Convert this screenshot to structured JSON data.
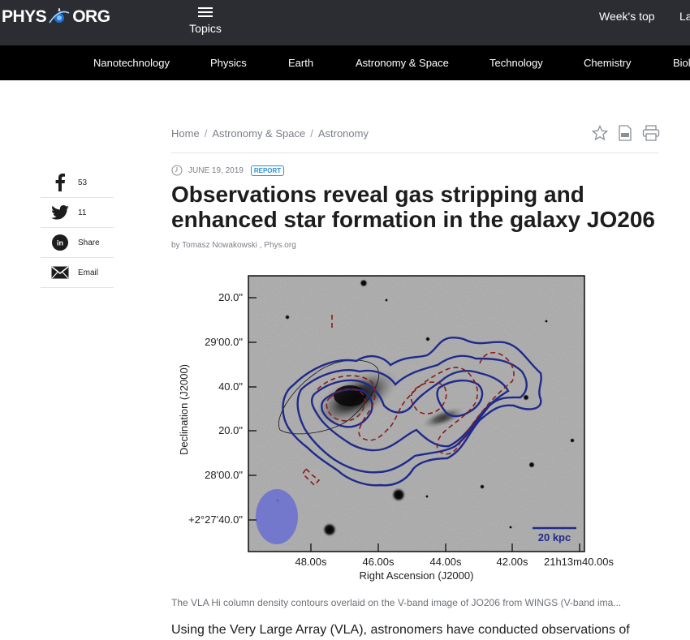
{
  "header": {
    "logo_left": "PHYS",
    "logo_right": "ORG",
    "topics_label": "Topics",
    "weeks_top_label": "Week's top",
    "latest_label": "La"
  },
  "categories": [
    "Nanotechnology",
    "Physics",
    "Earth",
    "Astronomy & Space",
    "Technology",
    "Chemistry",
    "Biol"
  ],
  "breadcrumb": [
    "Home",
    "Astronomy & Space",
    "Astronomy"
  ],
  "breadcrumb_sep": "/",
  "article": {
    "date": "JUNE 19, 2019",
    "badge": "REPORT",
    "title_line1": "Observations reveal gas stripping and",
    "title_line2": "enhanced star formation in the galaxy JO206",
    "byline": "by Tomasz Nowakowski , Phys.org",
    "caption": "The VLA Hi column density contours overlaid on the V-band image of JO206 from WINGS (V-band ima...",
    "lede": "Using the Very Large Array (VLA), astronomers have conducted observations of"
  },
  "share": [
    {
      "icon": "facebook-icon",
      "label": "53"
    },
    {
      "icon": "twitter-icon",
      "label": "11"
    },
    {
      "icon": "linkedin-icon",
      "label": "Share"
    },
    {
      "icon": "email-icon",
      "label": "Email"
    }
  ],
  "figure": {
    "ylabel": "Declination (J2000)",
    "xlabel": "Right Ascension (J2000)",
    "yticks": [
      "20.0\"",
      "29'00.0\"",
      "40.0\"",
      "20.0\"",
      "28'00.0\"",
      "+2°27'40.0\""
    ],
    "xticks": [
      "48.00s",
      "46.00s",
      "44.00s",
      "42.00s",
      "21h13m40.00s"
    ],
    "scale_label": "20 kpc",
    "contour_color": "#1f2a8c",
    "dashed_color": "#8b1a1a",
    "beam_color": "#6a6fd1"
  },
  "colors": {
    "topbar": "#2b2d33",
    "catbar": "#000000",
    "accent": "#2d8fd2"
  }
}
